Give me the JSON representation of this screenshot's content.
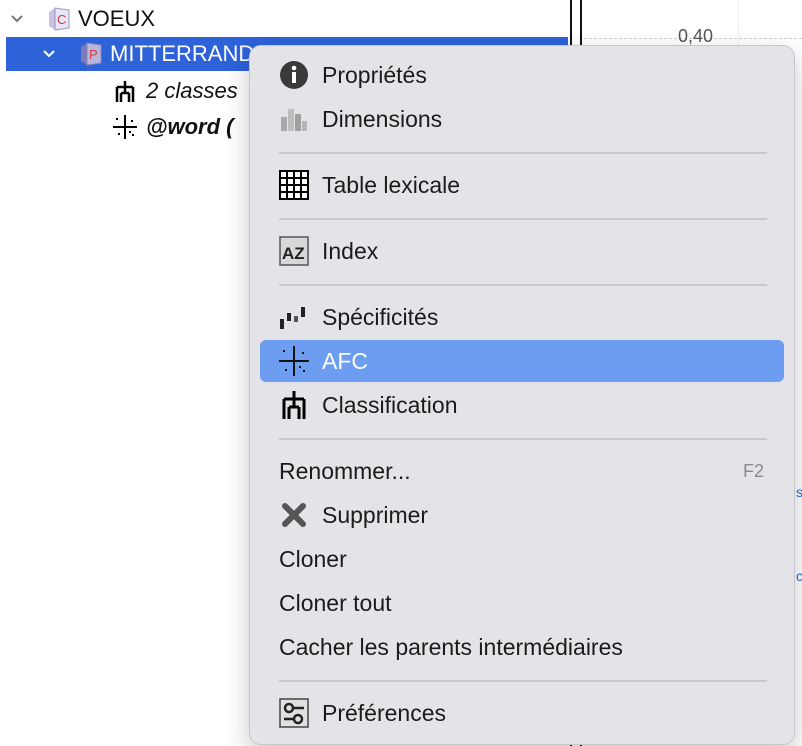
{
  "tree": {
    "root": {
      "label": "VOEUX",
      "icon": "corpus-icon"
    },
    "selected": {
      "label": "MITTERRAND",
      "icon": "partition-icon"
    },
    "children": [
      {
        "label": "2 classes",
        "icon": "classification-icon"
      },
      {
        "label": "@word (",
        "icon": "afc-icon"
      }
    ]
  },
  "background": {
    "axis_value": "0,40"
  },
  "menu": {
    "items": [
      {
        "label": "Propriétés",
        "icon": "info-icon"
      },
      {
        "label": "Dimensions",
        "icon": "dimensions-icon"
      },
      {
        "label": "Table lexicale",
        "icon": "table-grid-icon"
      },
      {
        "label": "Index",
        "icon": "az-index-icon"
      },
      {
        "label": "Spécificités",
        "icon": "specificities-icon"
      },
      {
        "label": "AFC",
        "icon": "afc-icon",
        "active": true
      },
      {
        "label": "Classification",
        "icon": "classification-icon"
      },
      {
        "label": "Renommer...",
        "shortcut": "F2"
      },
      {
        "label": "Supprimer",
        "icon": "delete-x-icon"
      },
      {
        "label": "Cloner"
      },
      {
        "label": "Cloner tout"
      },
      {
        "label": "Cacher les parents intermédiaires"
      },
      {
        "label": "Préférences",
        "icon": "preferences-icon"
      }
    ]
  },
  "colors": {
    "selection_bg": "#2d62d9",
    "menu_highlight": "#6c9df0",
    "menu_bg": "#e4e4e8"
  }
}
